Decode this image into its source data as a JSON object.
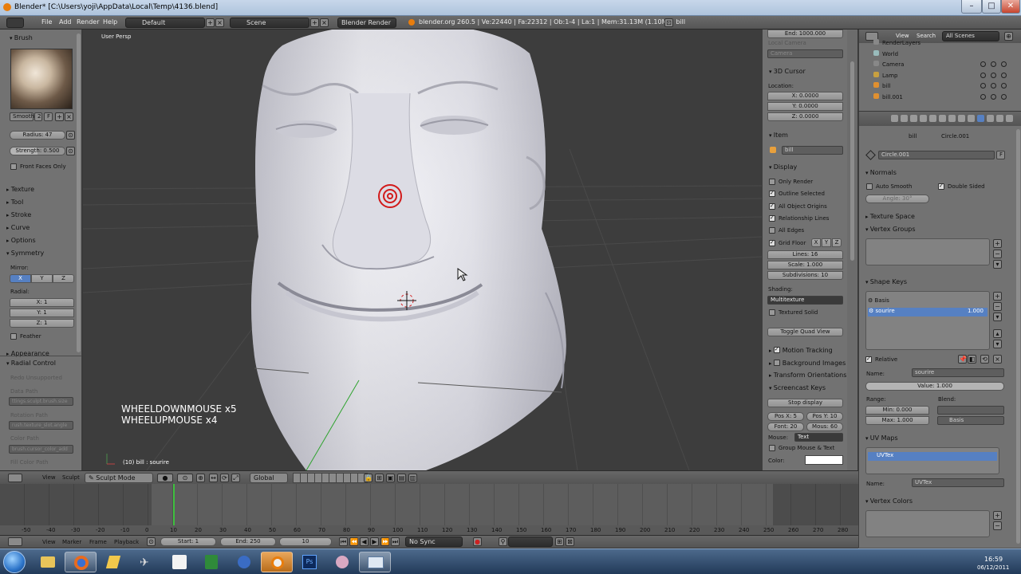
{
  "title_bar": {
    "title": "Blender* [C:\\Users\\yoji\\AppData\\Local\\Temp\\4136.blend]"
  },
  "info_header": {
    "menus": [
      "File",
      "Add",
      "Render",
      "Help"
    ],
    "screen_layout": "Default",
    "scene": "Scene",
    "render_engine": "Blender Render",
    "stats": "blender.org 260.5 | Ve:22440 | Fa:22312 | Ob:1-4 | La:1 | Mem:31.13M (1.10M) | bill"
  },
  "tool_shelf": {
    "brush_header": "Brush",
    "brush_name": "Smooth",
    "brush_users": "2",
    "brush_f": "F",
    "radius": "Radius: 47",
    "strength": "Strength: 0.500",
    "front_faces_only": "Front Faces Only",
    "panels": [
      "Texture",
      "Tool",
      "Stroke",
      "Curve",
      "Options"
    ],
    "symmetry": "Symmetry",
    "mirror_label": "Mirror:",
    "mirror_axes": [
      "X",
      "Y",
      "Z"
    ],
    "radial_label": "Radial:",
    "radial_values": [
      "X: 1",
      "Y: 1",
      "Z: 1"
    ],
    "feather": "Feather",
    "appearance": "Appearance",
    "radial_control": "Radial Control",
    "redo_unsupported": "Redo Unsupported",
    "data_path_label": "Data Path",
    "data_path": "ttings.sculpt.brush.size",
    "rotation_path_label": "Rotation Path",
    "rotation_path": "rush.texture_slot.angle",
    "color_path_label": "Color Path",
    "color_path": "brush.cursor_color_add",
    "fill_color_path_label": "Fill Color Path"
  },
  "viewport": {
    "view_label": "User Persp",
    "object_label": "(10) bill : sourire",
    "screencast_lines": [
      "WHEELDOWNMOUSE x5",
      "WHEELUPMOUSE x4"
    ]
  },
  "n_panel": {
    "end": "End: 1000.000",
    "local_camera_label": "Local Camera",
    "camera": "Camera",
    "cursor_header": "3D Cursor",
    "location_label": "Location:",
    "cursor_xyz": [
      "X: 0.0000",
      "Y: 0.0000",
      "Z: 0.0000"
    ],
    "item_header": "Item",
    "item_name": "bill",
    "display_header": "Display",
    "display_options": [
      {
        "label": "Only Render",
        "checked": false
      },
      {
        "label": "Outline Selected",
        "checked": true
      },
      {
        "label": "All Object Origins",
        "checked": true
      },
      {
        "label": "Relationship Lines",
        "checked": true
      },
      {
        "label": "All Edges",
        "checked": false
      },
      {
        "label": "Grid Floor",
        "checked": true
      }
    ],
    "grid_axes": [
      "X",
      "Y",
      "Z"
    ],
    "lines": "Lines: 16",
    "scale": "Scale: 1.000",
    "subdivisions": "Subdivisions: 10",
    "shading_label": "Shading:",
    "shading": "Multitexture",
    "textured_solid": "Textured Solid",
    "toggle_quad": "Toggle Quad View",
    "motion_tracking": "Motion Tracking",
    "background_images": "Background Images",
    "transform_orientations": "Transform Orientations",
    "screencast_keys": "Screencast Keys",
    "stop_display": "Stop display",
    "pos_x": "Pos X: 5",
    "pos_y": "Pos Y: 10",
    "font": "Font: 20",
    "mous": "Mous: 60",
    "mouse_label": "Mouse:",
    "mouse_value": "Text",
    "group_mouse": "Group Mouse & Text",
    "color_label": "Color:"
  },
  "outliner": {
    "view": "View",
    "search": "Search",
    "filter": "All Scenes",
    "items": [
      "RenderLayers",
      "World",
      "Camera",
      "Lamp",
      "bill",
      "bill.001"
    ]
  },
  "properties": {
    "breadcrumb_obj": "bill",
    "breadcrumb_mesh": "Circle.001",
    "mesh_name": "Circle.001",
    "mesh_f": "F",
    "normals_header": "Normals",
    "auto_smooth": "Auto Smooth",
    "double_sided": "Double Sided",
    "angle": "Angle: 30°",
    "texture_space": "Texture Space",
    "vertex_groups": "Vertex Groups",
    "shape_keys": "Shape Keys",
    "shape_key_items": [
      {
        "name": "Basis",
        "value": ""
      },
      {
        "name": "sourire",
        "value": "1.000"
      }
    ],
    "relative": "Relative",
    "name_label": "Name:",
    "shape_name": "sourire",
    "value": "Value: 1.000",
    "range_label": "Range:",
    "blend_label": "Blend:",
    "min": "Min: 0.000",
    "max": "Max: 1.000",
    "blend_basis": "Basis",
    "uv_maps": "UV Maps",
    "uv_item": "UVTex",
    "uv_name_label": "Name:",
    "uv_name": "UVTex",
    "vertex_colors": "Vertex Colors"
  },
  "viewport_header": {
    "view": "View",
    "sculpt": "Sculpt",
    "mode": "Sculpt Mode",
    "orientation": "Global"
  },
  "timeline": {
    "ticks": [
      "-50",
      "-40",
      "-30",
      "-20",
      "-10",
      "0",
      "10",
      "20",
      "30",
      "40",
      "50",
      "60",
      "70",
      "80",
      "90",
      "100",
      "110",
      "120",
      "130",
      "140",
      "150",
      "160",
      "170",
      "180",
      "190",
      "200",
      "210",
      "220",
      "230",
      "240",
      "250",
      "260",
      "270",
      "280"
    ],
    "menus": [
      "View",
      "Marker",
      "Frame",
      "Playback"
    ],
    "start": "Start: 1",
    "end": "End: 250",
    "current": "10",
    "sync": "No Sync"
  },
  "taskbar": {
    "time": "16:59",
    "date": "06/12/2011"
  }
}
